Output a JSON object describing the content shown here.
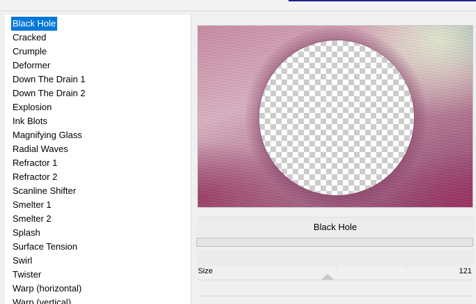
{
  "filters": {
    "selected_index": 0,
    "items": [
      "Black Hole",
      "Cracked",
      "Crumple",
      "Deformer",
      "Down The Drain 1",
      "Down The Drain 2",
      "Explosion",
      "Ink Blots",
      "Magnifying Glass",
      "Radial Waves",
      "Refractor 1",
      "Refractor 2",
      "Scanline Shifter",
      "Smelter 1",
      "Smelter 2",
      "Splash",
      "Surface Tension",
      "Swirl",
      "Twister",
      "Warp (horizontal)",
      "Warp (vertical)"
    ]
  },
  "preview": {
    "filter_title": "Black Hole"
  },
  "parameters": {
    "size_label": "Size",
    "size_value": "121"
  },
  "colors": {
    "selection": "#0078d7",
    "panel_bg": "#ffffff",
    "window_bg": "#f0f0f0"
  }
}
